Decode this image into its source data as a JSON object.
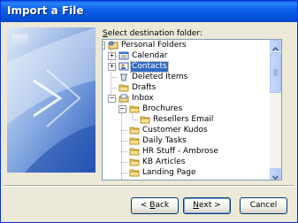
{
  "window": {
    "title": "Import a File"
  },
  "prompt": {
    "prefix": "S",
    "rest": "elect destination folder:"
  },
  "tree": {
    "items": [
      {
        "label": "Personal Folders",
        "icon": "personal-folders-icon",
        "expander": "minus",
        "selected": false
      },
      {
        "label": "Calendar",
        "icon": "calendar-icon",
        "expander": "plus",
        "selected": false
      },
      {
        "label": "Contacts",
        "icon": "contacts-icon",
        "expander": "plus",
        "selected": true
      },
      {
        "label": "Deleted Items",
        "icon": "deleted-items-icon",
        "expander": "",
        "selected": false
      },
      {
        "label": "Drafts",
        "icon": "folder-icon",
        "expander": "",
        "selected": false
      },
      {
        "label": "Inbox",
        "icon": "inbox-icon",
        "expander": "minus",
        "selected": false
      },
      {
        "label": "Brochures",
        "icon": "folder-icon",
        "expander": "minus",
        "selected": false
      },
      {
        "label": "Resellers Email",
        "icon": "folder-icon",
        "expander": "",
        "selected": false
      },
      {
        "label": "Customer Kudos",
        "icon": "folder-icon",
        "expander": "",
        "selected": false
      },
      {
        "label": "Daily Tasks",
        "icon": "folder-icon",
        "expander": "",
        "selected": false
      },
      {
        "label": "HR Stuff - Ambrose",
        "icon": "folder-icon",
        "expander": "",
        "selected": false
      },
      {
        "label": "KB Articles",
        "icon": "folder-icon",
        "expander": "",
        "selected": false
      },
      {
        "label": "Landing Page",
        "icon": "folder-icon",
        "expander": "",
        "selected": false
      }
    ]
  },
  "buttons": {
    "back": {
      "arrow": "<",
      "hotkey": "B",
      "rest": "ack"
    },
    "next": {
      "hotkey": "N",
      "rest": "ext",
      "arrow": ">"
    },
    "cancel": "Cancel"
  }
}
